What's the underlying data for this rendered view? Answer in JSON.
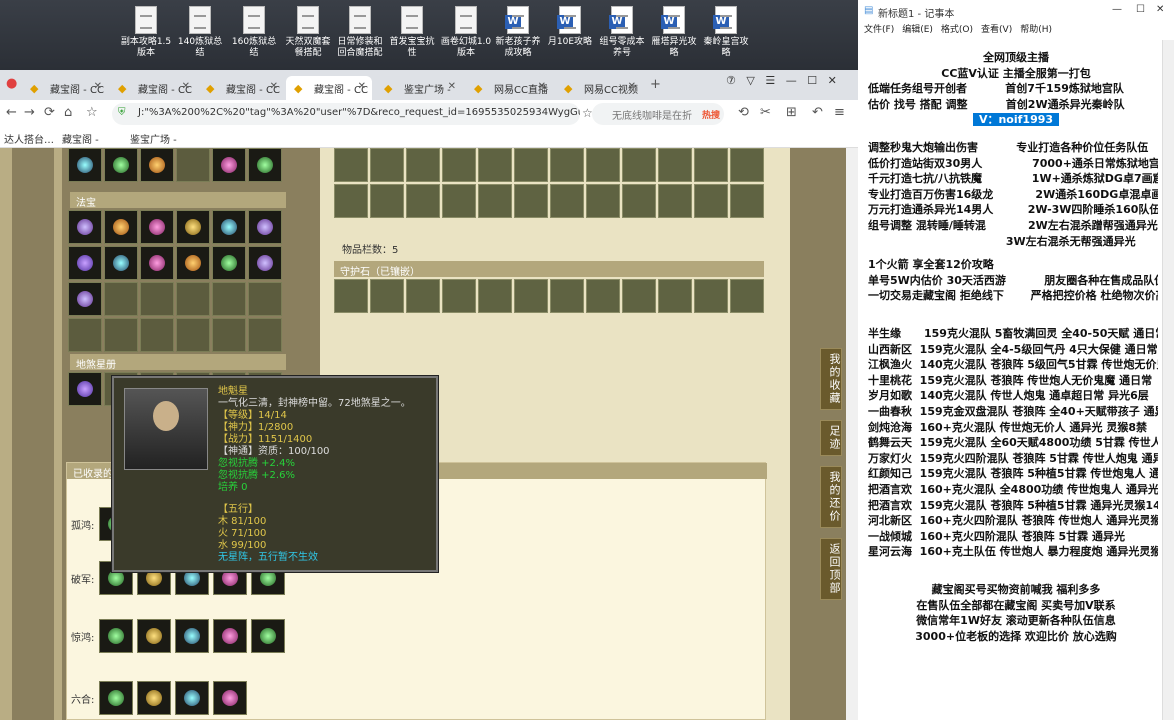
{
  "desktop": {
    "icons": [
      {
        "label": "副本攻略1.5版本",
        "type": "doc"
      },
      {
        "label": "140炼狱总结",
        "type": "doc"
      },
      {
        "label": "160炼狱总结",
        "type": "doc"
      },
      {
        "label": "天然双魔套餐搭配",
        "type": "doc"
      },
      {
        "label": "日常修装和回合魔搭配",
        "type": "doc"
      },
      {
        "label": "首发宝宝抗性",
        "type": "doc"
      },
      {
        "label": "画卷幻城1.0版本",
        "type": "doc"
      },
      {
        "label": "新老孩子养成攻略",
        "type": "word"
      },
      {
        "label": "月10E攻略",
        "type": "word"
      },
      {
        "label": "组号零成本养号",
        "type": "word"
      },
      {
        "label": "雁塔异光攻略",
        "type": "word"
      },
      {
        "label": "秦岭皇宫攻略",
        "type": "word"
      }
    ]
  },
  "browser": {
    "tabs": [
      {
        "label": "藏宝阁 - CC"
      },
      {
        "label": "藏宝阁 - CC"
      },
      {
        "label": "藏宝阁 - CC"
      },
      {
        "label": "藏宝阁 - CC",
        "active": true
      },
      {
        "label": "鉴宝广场 - "
      },
      {
        "label": "网易CC直播"
      },
      {
        "label": "网易CC视频"
      }
    ],
    "url": "J:\"%3A%200%2C%20\"tag\"%3A%20\"user\"%7D&reco_request_id=1695535025934WygGu",
    "search_placeholder": "无底线咖啡是在折",
    "search_badge": "热搜",
    "bookmarks": [
      "达人搭台…",
      "藏宝阁 - ",
      "鉴宝广场 - "
    ]
  },
  "page": {
    "fabao_title": "法宝",
    "dishax_title": "地煞星册",
    "item_count_label": "物品栏数：5",
    "guard_title": "守护石（已镶嵌）",
    "collected_title": "已收录的",
    "rows": [
      {
        "label": "孤鸿:"
      },
      {
        "label": "破军:"
      },
      {
        "label": "惊鸿:"
      },
      {
        "label": "六合:"
      }
    ],
    "float_nav": [
      "我的收藏",
      "足迹",
      "我的还价",
      "返回顶部"
    ]
  },
  "tooltip": {
    "name": "地魁星",
    "desc": "一气化三清，封神榜中留。72地煞星之一。",
    "level": "【等级】14/14",
    "shenli": "【神力】1/2800",
    "zhanli": "【战力】1151/1400",
    "shentong": "【神通】资质：100/100",
    "bonus1": "忽视抗腾 +2.4%",
    "bonus2": "忽视抗腾 +2.6%",
    "peiyang": "培养 0",
    "wuxing_title": "【五行】",
    "wood": "木 81/100",
    "fire": "火 71/100",
    "water": "水 99/100",
    "wuxing_note": "无星阵，五行暂不生效"
  },
  "notepad": {
    "title": "新标题1 - 记事本",
    "menu": [
      "文件(F)",
      "编辑(E)",
      "格式(O)",
      "查看(V)",
      "帮助(H)"
    ],
    "header": [
      "全网顶级主播",
      "CC蓝V认证 主播全服第一打包",
      "低端任务组号开创者          首创7千159炼狱地宫队",
      "估价 找号 搭配 调整          首创2W通杀异光秦岭队"
    ],
    "contact": "V：noif1993",
    "services": [
      "调整秒鬼大炮输出伤害          专业打造各种价位任务队伍",
      "低价打造站街双30男人             7000+通杀日常炼狱地宫",
      "千元打造七抗/八抗铁魔             1W+通杀炼狱DG卓7画窟",
      "专业打造百万伤害16级龙           2W通杀160DG卓混卓画",
      "万元打造通杀异光14男人         2W-3W四阶睡杀160队伍",
      "组号调整 混转睡/睡转混           2W左右混杀蹭帮强通异光",
      "                                    3W左右混杀无帮强通异光",
      "1个火箭 享全套12价攻略",
      "单号5W内估价 30天活西游          朋友圈各种在售成品队伍",
      "一切交易走藏宝阁 拒绝线下       严格把控价格 杜绝物次价高"
    ],
    "teams": [
      "半生缘      159克火混队 5畜牧满回灵 全40-50天赋 通日常",
      "山西新区  159克火混队 全4-5级回气丹 4只大保健 通日常",
      "江枫渔火  140克火混队 苍狼阵 5级回气5甘霖 传世炮无价鬼人",
      "十里桃花  159克火混队 苍狼阵 传世炮人无价鬼魔 通日常",
      "岁月如歌  140克火混队 传世人炮鬼 通卓超日常 异光6层",
      "一曲春秋  159克金双盘混队 苍狼阵 全40+天赋带孩子 通异光",
      "剑炖沧海  160+克火混队 传世炮无价人 通异光 灵猴8禁",
      "鹤舞云天  159克火混队 全60天赋4800功绩 5甘霖 传世人炮",
      "万家灯火  159克火四阶混队 苍狼阵 5甘霖 传世人炮鬼 通异光",
      "红颜知己  159克火混队 苍狼阵 5种植5甘霖 传世炮鬼人 通异光",
      "把酒言欢  160+克火混队 全4800功绩 传世炮鬼人 通异光灵猴",
      "把酒言欢  159克火混队 苍狼阵 5种植5甘霖 通异光灵猴14",
      "河北新区  160+克火四阶混队 苍狼阵 传世炮人 通异光灵猴14",
      "一战倾城  160+克火四阶混队 苍狼阵 5甘霖 通异光",
      "星河云海  160+克土队伍 传世炮人 暴力程度炮 通异光灵猴14"
    ],
    "footer": [
      "藏宝阁买号买物资前喊我 福利多多",
      "在售队伍全部都在藏宝阁 买卖号加V联系",
      "微信常年1W好友 滚动更新各种队伍信息",
      "3000+位老板的选择 欢迎比价 放心选购"
    ]
  }
}
